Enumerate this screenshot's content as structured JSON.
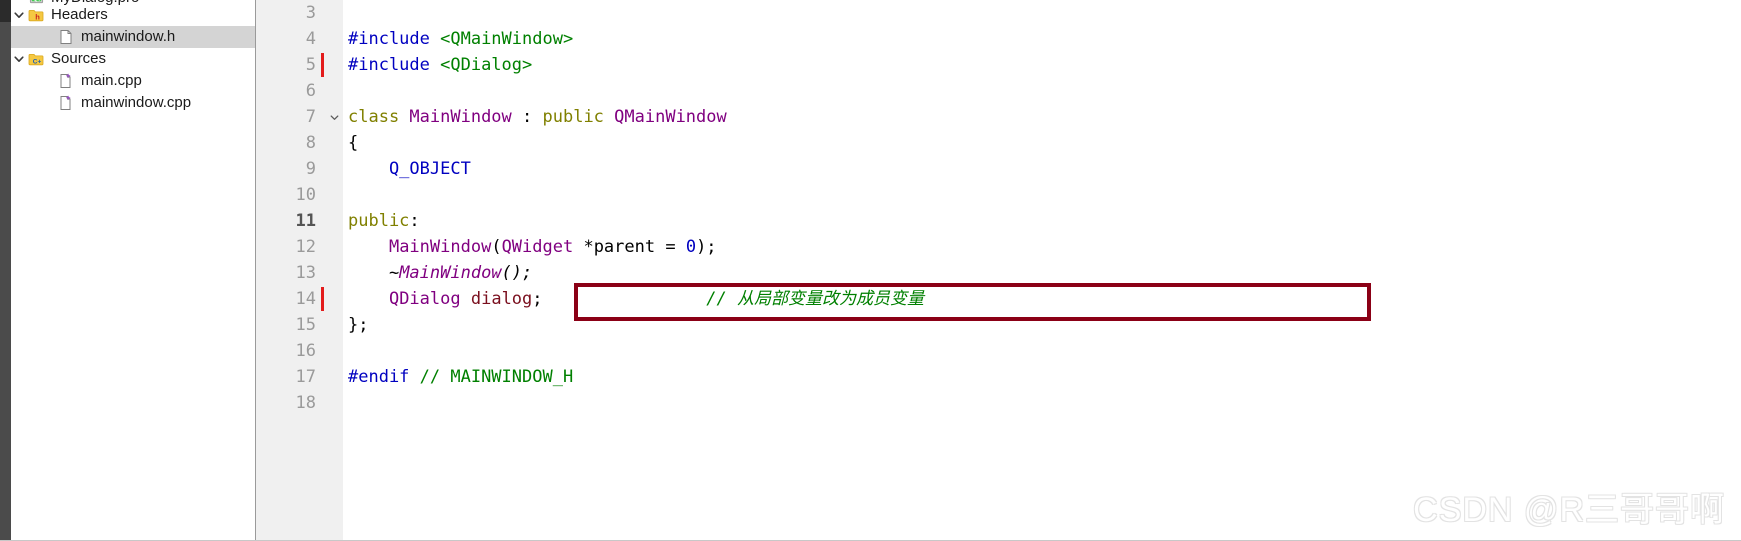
{
  "sidebar": {
    "items": [
      {
        "label": "MyDialog.pro",
        "icon": "qt-project-icon",
        "indent": 0,
        "twisty": "none",
        "selected": false,
        "partial_top": true
      },
      {
        "label": "Headers",
        "icon": "headers-folder-icon",
        "indent": 0,
        "twisty": "expanded",
        "selected": false
      },
      {
        "label": "mainwindow.h",
        "icon": "header-file-icon",
        "indent": 1,
        "twisty": "none",
        "selected": true
      },
      {
        "label": "Sources",
        "icon": "sources-folder-icon",
        "indent": 0,
        "twisty": "expanded",
        "selected": false
      },
      {
        "label": "main.cpp",
        "icon": "cpp-file-icon",
        "indent": 1,
        "twisty": "none",
        "selected": false
      },
      {
        "label": "mainwindow.cpp",
        "icon": "cpp-file-icon",
        "indent": 1,
        "twisty": "none",
        "selected": false
      }
    ]
  },
  "editor": {
    "lines": [
      {
        "number": "3",
        "current": false,
        "modified": false,
        "fold": "none",
        "tokens": []
      },
      {
        "number": "4",
        "current": false,
        "modified": false,
        "fold": "none",
        "tokens": [
          {
            "text": "#include ",
            "cls": "tok-pre"
          },
          {
            "text": "<QMainWindow>",
            "cls": "tok-header"
          }
        ]
      },
      {
        "number": "5",
        "current": false,
        "modified": true,
        "fold": "none",
        "tokens": [
          {
            "text": "#include ",
            "cls": "tok-pre"
          },
          {
            "text": "<QDialog>",
            "cls": "tok-header"
          }
        ]
      },
      {
        "number": "6",
        "current": false,
        "modified": false,
        "fold": "none",
        "tokens": []
      },
      {
        "number": "7",
        "current": false,
        "modified": false,
        "fold": "expanded",
        "tokens": [
          {
            "text": "class ",
            "cls": "tok-kw"
          },
          {
            "text": "MainWindow",
            "cls": "tok-type"
          },
          {
            "text": " : ",
            "cls": "tok-plain"
          },
          {
            "text": "public ",
            "cls": "tok-kw"
          },
          {
            "text": "QMainWindow",
            "cls": "tok-type"
          }
        ]
      },
      {
        "number": "8",
        "current": false,
        "modified": false,
        "fold": "none",
        "tokens": [
          {
            "text": "{",
            "cls": "tok-plain"
          }
        ]
      },
      {
        "number": "9",
        "current": false,
        "modified": false,
        "fold": "none",
        "tokens": [
          {
            "text": "    Q_OBJECT",
            "cls": "tok-macro"
          }
        ]
      },
      {
        "number": "10",
        "current": false,
        "modified": false,
        "fold": "none",
        "tokens": []
      },
      {
        "number": "11",
        "current": true,
        "modified": false,
        "fold": "none",
        "tokens": [
          {
            "text": "public",
            "cls": "tok-kw"
          },
          {
            "text": ":",
            "cls": "tok-plain"
          }
        ]
      },
      {
        "number": "12",
        "current": false,
        "modified": false,
        "fold": "none",
        "tokens": [
          {
            "text": "    ",
            "cls": "tok-plain"
          },
          {
            "text": "MainWindow",
            "cls": "tok-type"
          },
          {
            "text": "(",
            "cls": "tok-plain"
          },
          {
            "text": "QWidget",
            "cls": "tok-type"
          },
          {
            "text": " *parent = ",
            "cls": "tok-plain"
          },
          {
            "text": "0",
            "cls": "tok-num"
          },
          {
            "text": ");",
            "cls": "tok-plain"
          }
        ]
      },
      {
        "number": "13",
        "current": false,
        "modified": false,
        "fold": "none",
        "tokens": [
          {
            "text": "    ~",
            "cls": "tok-plain"
          },
          {
            "text": "MainWindow",
            "cls": "tok-type tok-italic"
          },
          {
            "text": "();",
            "cls": "tok-plain tok-italic"
          }
        ]
      },
      {
        "number": "14",
        "current": false,
        "modified": true,
        "fold": "none",
        "tokens": [
          {
            "text": "    ",
            "cls": "tok-plain"
          },
          {
            "text": "QDialog",
            "cls": "tok-type"
          },
          {
            "text": " ",
            "cls": "tok-plain"
          },
          {
            "text": "dialog",
            "cls": "tok-var"
          },
          {
            "text": ";                ",
            "cls": "tok-plain"
          },
          {
            "text": "// 从局部变量改为成员变量",
            "cls": "tok-comment-i"
          }
        ]
      },
      {
        "number": "15",
        "current": false,
        "modified": false,
        "fold": "none",
        "tokens": [
          {
            "text": "};",
            "cls": "tok-plain"
          }
        ]
      },
      {
        "number": "16",
        "current": false,
        "modified": false,
        "fold": "none",
        "tokens": []
      },
      {
        "number": "17",
        "current": false,
        "modified": false,
        "fold": "none",
        "tokens": [
          {
            "text": "#endif ",
            "cls": "tok-pre"
          },
          {
            "text": "// MAINWINDOW_H",
            "cls": "tok-comment"
          }
        ]
      },
      {
        "number": "18",
        "current": false,
        "modified": false,
        "fold": "none",
        "tokens": []
      }
    ]
  },
  "annotation": {
    "shape": "rectangle",
    "color": "#8b0016",
    "target_line": "14"
  },
  "watermark": {
    "text": "CSDN @R三哥哥啊"
  },
  "colors": {
    "annotation_red": "#8b0016",
    "change_marker_red": "#e31b1b",
    "gutter_bg": "#f0f0f0",
    "selection_bg": "#d4d4d4",
    "left_strip": "#4b4b4b"
  }
}
